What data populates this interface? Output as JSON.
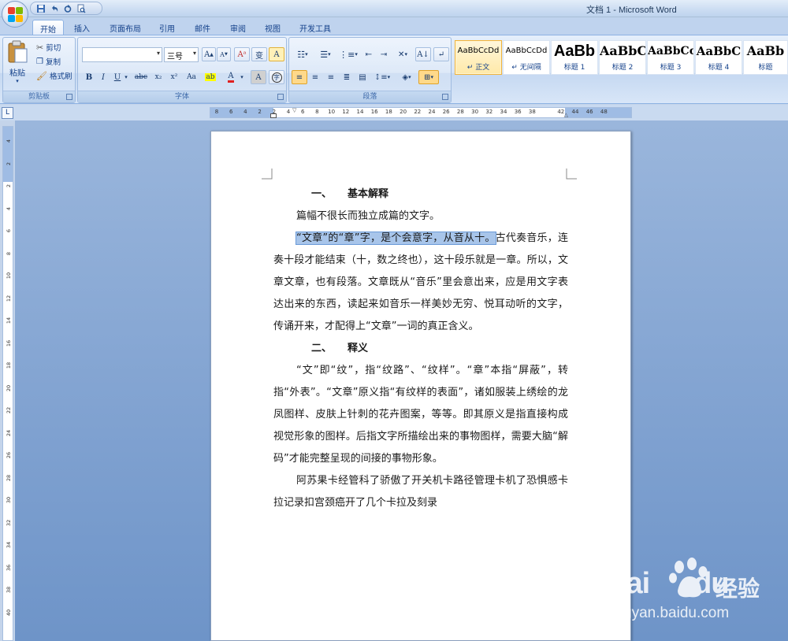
{
  "window": {
    "title": "文档 1 - Microsoft Word"
  },
  "quick_access": [
    {
      "icon": "save-icon"
    },
    {
      "icon": "undo-icon"
    },
    {
      "icon": "redo-icon"
    },
    {
      "icon": "print-preview-icon"
    }
  ],
  "tabs": [
    {
      "label": "开始",
      "active": true
    },
    {
      "label": "插入"
    },
    {
      "label": "页面布局"
    },
    {
      "label": "引用"
    },
    {
      "label": "邮件"
    },
    {
      "label": "审阅"
    },
    {
      "label": "视图"
    },
    {
      "label": "开发工具"
    }
  ],
  "clipboard": {
    "paste_label": "粘贴",
    "cut_label": "剪切",
    "copy_label": "复制",
    "format_painter_label": "格式刷",
    "group_label": "剪贴板"
  },
  "font": {
    "font_name": "",
    "font_size": "三号",
    "bold": "B",
    "italic": "I",
    "underline": "U",
    "strikethrough": "abc",
    "subscript": "x₂",
    "superscript": "x²",
    "change_case": "Aa",
    "font_color_glyph": "A",
    "grow_font": "A",
    "shrink_font": "A",
    "clear_format_glyph": "A",
    "char_border_glyph": "A",
    "group_label": "字体"
  },
  "paragraph": {
    "group_label": "段落"
  },
  "styles": {
    "items": [
      {
        "sample": "AaBbCcDd",
        "name": "正文",
        "selected": true
      },
      {
        "sample": "AaBbCcDd",
        "name": "无间隔"
      },
      {
        "sample": "AaBb",
        "name": "标题 1"
      },
      {
        "sample": "AaBbC",
        "name": "标题 2"
      },
      {
        "sample": "AaBbCc",
        "name": "标题 3"
      },
      {
        "sample": "AaBbC",
        "name": "标题 4"
      },
      {
        "sample": "AaBb",
        "name": "标题"
      }
    ]
  },
  "ruler": {
    "numbers": [
      "8",
      "6",
      "4",
      "2",
      "2",
      "4",
      "6",
      "8",
      "10",
      "12",
      "14",
      "16",
      "18",
      "20",
      "22",
      "24",
      "26",
      "28",
      "30",
      "32",
      "34",
      "36",
      "38",
      "42",
      "44",
      "46",
      "48"
    ],
    "vertical_numbers": [
      "4",
      "2",
      "2",
      "4",
      "6",
      "8",
      "10",
      "12",
      "14",
      "16",
      "18",
      "20",
      "22",
      "24",
      "26",
      "28",
      "30",
      "32",
      "34",
      "36",
      "38",
      "40"
    ]
  },
  "document": {
    "heading1_num": "一、",
    "heading1": "基本解释",
    "para1": "篇幅不很长而独立成篇的文字。",
    "para2_selected": "“文章”的“章”字，是个会意字，从音从十。",
    "para2_rest": "古代奏音乐，连奏十段才能结束（十，数之终也），这十段乐就是一章。所以，文章文章，也有段落。文章既从“音乐”里会意出来，应是用文字表达出来的东西，读起来如音乐一样美妙无穷、悦耳动听的文字，传诵开来，才配得上“文章”一词的真正含义。",
    "heading2_num": "二、",
    "heading2": "释义",
    "para3": "“文”即“纹”，指“纹路”、“纹样”。“章”本指“屏蔽”，转指“外表”。“文章”原义指“有纹样的表面”，诸如服装上绣绘的龙凤图样、皮肤上针刺的花卉图案，等等。即其原义是指直接构成视觉形象的图样。后指文字所描绘出来的事物图样，需要大脑“解码”才能完整呈现的间接的事物形象。",
    "para4": "阿苏果卡经管科了骄傲了开关机卡路径管理卡机了恐惧感卡拉记录扣宫颈癌开了几个卡拉及刻录"
  },
  "watermark": {
    "brand": "Bai",
    "brand2": "du",
    "label": "经验",
    "url": "jingyan.baidu.com"
  }
}
